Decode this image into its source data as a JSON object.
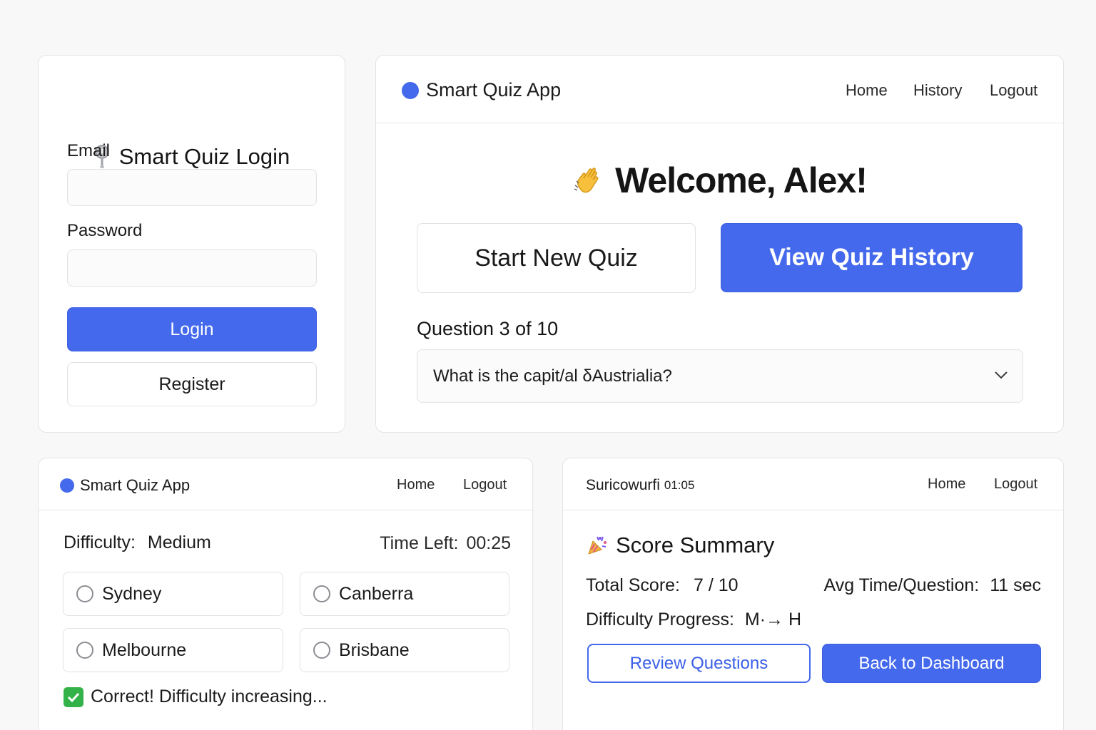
{
  "login": {
    "title": "Smart Quiz Login",
    "email_label": "Email",
    "email_value": "",
    "password_label": "Password",
    "password_value": "",
    "login_button": "Login",
    "register_button": "Register"
  },
  "dashboard": {
    "brand": "Smart Quiz App",
    "nav": [
      "Home",
      "History",
      "Logout"
    ],
    "welcome": "Welcome, Alex!",
    "start_button": "Start New Quiz",
    "history_button": "View Quiz History",
    "question_label": "Question 3 of 10",
    "question_select": "What is the capit/al δAustrialia?"
  },
  "quiz": {
    "brand": "Smart Quiz App",
    "nav": [
      "Home",
      "Logout"
    ],
    "difficulty_label": "Difficulty:",
    "difficulty_value": "Medium",
    "time_label": "Time Left:",
    "time_value": "00:25",
    "options": [
      "Sydney",
      "Canberra",
      "Melbourne",
      "Brisbane"
    ],
    "feedback": "Correct! Difficulty increasing..."
  },
  "summary": {
    "brand": "Suricowurfi",
    "timer": "01:05",
    "nav": [
      "Home",
      "Logout"
    ],
    "title": "Score Summary",
    "total_label": "Total Score:",
    "total_value": "7 / 10",
    "avg_label": "Avg Time/Question:",
    "avg_value": "11 sec",
    "progress_label": "Difficulty Progress:",
    "progress_value": "M·→ H",
    "review_button": "Review Questions",
    "back_button": "Back to Dashboard"
  },
  "colors": {
    "accent": "#4569ec",
    "success": "#34b24a",
    "background": "#f8f8f9",
    "card": "#ffffff",
    "border": "#e3e4e8"
  },
  "icons": {
    "login_title": "location-pin-icon",
    "welcome": "waving-hand-icon",
    "select": "chevron-down-icon",
    "feedback": "check-icon",
    "summary_title": "celebration-icon"
  }
}
